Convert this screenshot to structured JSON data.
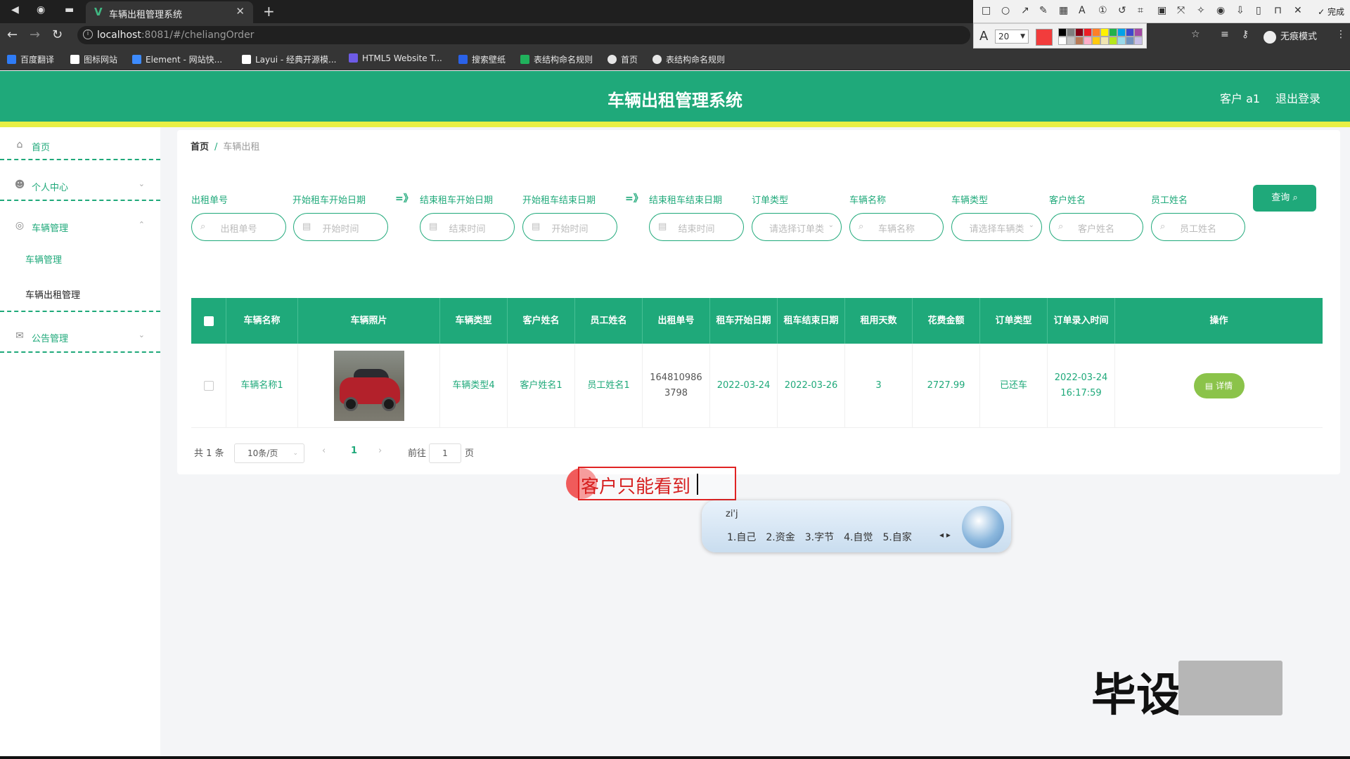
{
  "browser": {
    "tab_title": "车辆出租管理系统",
    "url_host": "localhost",
    "url_path": ":8081/#/cheliangOrder",
    "incognito_label": "无痕模式",
    "bookmarks": [
      "百度翻译",
      "图标网站",
      "Element - 网站快...",
      "Layui - 经典开源模...",
      "HTML5 Website T...",
      "搜索壁纸",
      "表结构命名规则",
      "首页",
      "表结构命名规则"
    ],
    "bookmark_colors": [
      "#2f7cf6",
      "#ffffff",
      "#3d8bfd",
      "#ffffff",
      "#6d5be6",
      "#2a62e8",
      "#20b25c",
      "#e6e6e6",
      "#e6e6e6"
    ]
  },
  "snip_tool": {
    "done_label": "完成",
    "font_size": "20",
    "current_color": "#f23c3c",
    "palette": [
      "#000000",
      "#7f7f7f",
      "#880015",
      "#ed1c24",
      "#ff7f27",
      "#fff200",
      "#22b14c",
      "#00a2e8",
      "#3f48cc",
      "#a349a4",
      "#ffffff",
      "#c3c3c3",
      "#b97a57",
      "#ffaec9",
      "#ffc90e",
      "#efe4b0",
      "#b5e61d",
      "#99d9ea",
      "#7092be",
      "#c8bfe7"
    ]
  },
  "header": {
    "title": "车辆出租管理系统",
    "user": "客户 a1",
    "logout": "退出登录"
  },
  "sidebar": {
    "home": "首页",
    "personal": "个人中心",
    "vehicle": "车辆管理",
    "vehicle_sub": [
      "车辆管理",
      "车辆出租管理"
    ],
    "notice": "公告管理"
  },
  "breadcrumb": {
    "home": "首页",
    "current": "车辆出租"
  },
  "filters": {
    "labels": [
      "出租单号",
      "开始租车开始日期",
      "结束租车开始日期",
      "开始租车结束日期",
      "结束租车结束日期",
      "订单类型",
      "车辆名称",
      "车辆类型",
      "客户姓名",
      "员工姓名"
    ],
    "placeholders": [
      "出租单号",
      "开始时间",
      "结束时间",
      "开始时间",
      "结束时间",
      "请选择订单类",
      "车辆名称",
      "请选择车辆类",
      "客户姓名",
      "员工姓名"
    ],
    "range_sep": "=》",
    "query": "查询"
  },
  "table": {
    "headers": [
      "车辆名称",
      "车辆照片",
      "车辆类型",
      "客户姓名",
      "员工姓名",
      "出租单号",
      "租车开始日期",
      "租车结束日期",
      "租用天数",
      "花费金额",
      "订单类型",
      "订单录入时间",
      "操作"
    ],
    "rows": [
      {
        "name": "车辆名称1",
        "type": "车辆类型4",
        "customer": "客户姓名1",
        "employee": "员工姓名1",
        "order_no": "1648109863798",
        "start": "2022-03-24",
        "end": "2022-03-26",
        "days": "3",
        "amount": "2727.99",
        "order_type": "已还车",
        "created": "2022-03-24 16:17:59",
        "action": "详情"
      }
    ]
  },
  "pagination": {
    "total": "共 1 条",
    "page_size": "10条/页",
    "current": "1",
    "goto_prefix": "前往",
    "goto_value": "1",
    "goto_suffix": "页"
  },
  "annotation": {
    "text": "客户只能看到"
  },
  "ime": {
    "composition": "zi'j",
    "candidates": [
      "1.自己",
      "2.资金",
      "3.字节",
      "4.自觉",
      "5.自家"
    ]
  },
  "watermark": {
    "text": "毕设"
  }
}
